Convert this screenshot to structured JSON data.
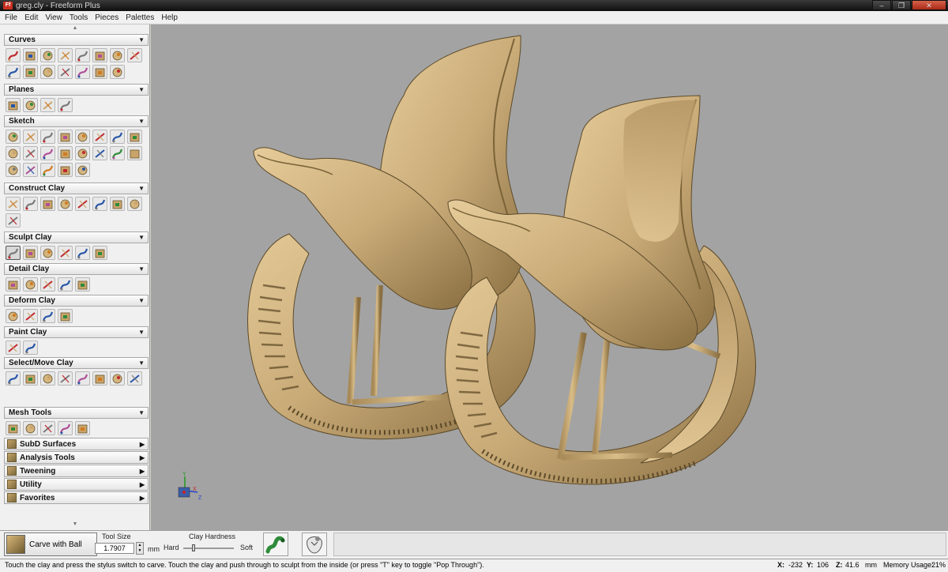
{
  "window": {
    "title": "greg.cly - Freeform Plus",
    "app_icon": "Ff",
    "controls": [
      "–",
      "❐",
      "✕"
    ]
  },
  "menu": [
    "File",
    "Edit",
    "View",
    "Tools",
    "Pieces",
    "Palettes",
    "Help"
  ],
  "palettes": {
    "curves": "Curves",
    "planes": "Planes",
    "sketch": "Sketch",
    "construct": "Construct Clay",
    "sculpt": "Sculpt Clay",
    "detail": "Detail Clay",
    "deform": "Deform Clay",
    "paint": "Paint Clay",
    "select": "Select/Move Clay",
    "mesh": "Mesh Tools"
  },
  "collapsed_palettes": [
    "SubD Surfaces",
    "Analysis Tools",
    "Tweening",
    "Utility",
    "Favorites"
  ],
  "tool_icon_names": {
    "curves": [
      "arrow-icon",
      "curve-draw-icon",
      "curve-edit-icon",
      "curve-project-icon",
      "curve-extract-icon",
      "curve-spiral-icon",
      "curve-offset-icon",
      "curve-cut-icon",
      "curve-fillet-icon",
      "curve-blend-icon",
      "curve-spline-icon",
      "curve-mirror-icon",
      "curve-split-icon",
      "curve-surface-icon",
      "curve-trim-icon"
    ],
    "planes": [
      "plane-new-icon",
      "plane-box-icon",
      "plane-axis-icon",
      "plane-move-icon"
    ],
    "sketch": [
      "sketch-plane-icon",
      "sketch-snap-icon",
      "pen-icon",
      "pencil-icon",
      "freehand-icon",
      "polyline-icon",
      "spline-icon",
      "line-icon",
      "arc-icon",
      "corner-icon",
      "circle-icon",
      "ellipse-icon",
      "rectangle-icon",
      "trim-icon",
      "mirror-icon",
      "fillet-icon",
      "angle-icon",
      "pattern-icon",
      "image-icon",
      "fill-icon",
      "export-icon"
    ],
    "construct": [
      "extrude-icon",
      "loft-icon",
      "wrap-icon",
      "revolve-icon",
      "sweep-icon",
      "face-icon",
      "helix-icon",
      "hand-icon",
      "bottle-icon"
    ],
    "sculpt": [
      "carve-ball-icon",
      "smudge-icon",
      "tug-icon",
      "attract-icon",
      "smooth-icon",
      "ring-icon"
    ],
    "detail": [
      "emboss-icon",
      "deboss-icon",
      "texture-icon",
      "stamp-icon",
      "sphere-pattern-icon"
    ],
    "deform": [
      "deform-tug-icon",
      "deform-scale-icon",
      "deform-bend-icon",
      "deform-warp-icon"
    ],
    "paint": [
      "paint-palette-icon",
      "paint-ball-icon"
    ],
    "select": [
      "select-icon",
      "select-ball-icon",
      "select-green-icon",
      "select-hand-icon",
      "select-tool-icon",
      "select-cube-icon",
      "move-star-icon",
      "move-axis-icon"
    ],
    "mesh": [
      "mesh-sphere-icon",
      "mesh-smooth-icon",
      "mesh-edit-icon",
      "mesh-play-icon",
      "mesh-triangle-icon"
    ]
  },
  "tool_colors": {
    "red": "#c0282c",
    "blue": "#2856a8",
    "green": "#2e8b3a",
    "clay": "#c9a46a",
    "gray": "#7a7a7a"
  },
  "viewport": {
    "background": "#a3a3a3",
    "clay_color": "#c9ab78",
    "axis_labels": [
      "Y",
      "X",
      "Z"
    ],
    "axis_colors": {
      "y": "#1e9b1e",
      "x": "#cc2222",
      "z": "#2244cc"
    }
  },
  "bottom": {
    "tool_name": "Carve with Ball",
    "tool_size_label": "Tool Size",
    "tool_size_value": "1.7907",
    "unit": "mm",
    "clay_hardness_label": "Clay Hardness",
    "hard_label": "Hard",
    "soft_label": "Soft",
    "clay_hardness_level": 0.2
  },
  "status": {
    "message": "Touch the clay and press the stylus switch to carve. Touch the clay and push through to sculpt from the inside (or press \"T\" key to toggle \"Pop Through\").",
    "x_label": "X:",
    "x": "-232",
    "y_label": "Y:",
    "y": "106",
    "z_label": "Z:",
    "z": "41.6",
    "unit": "mm",
    "memory_label": "Memory Usage:",
    "memory": "21%"
  }
}
